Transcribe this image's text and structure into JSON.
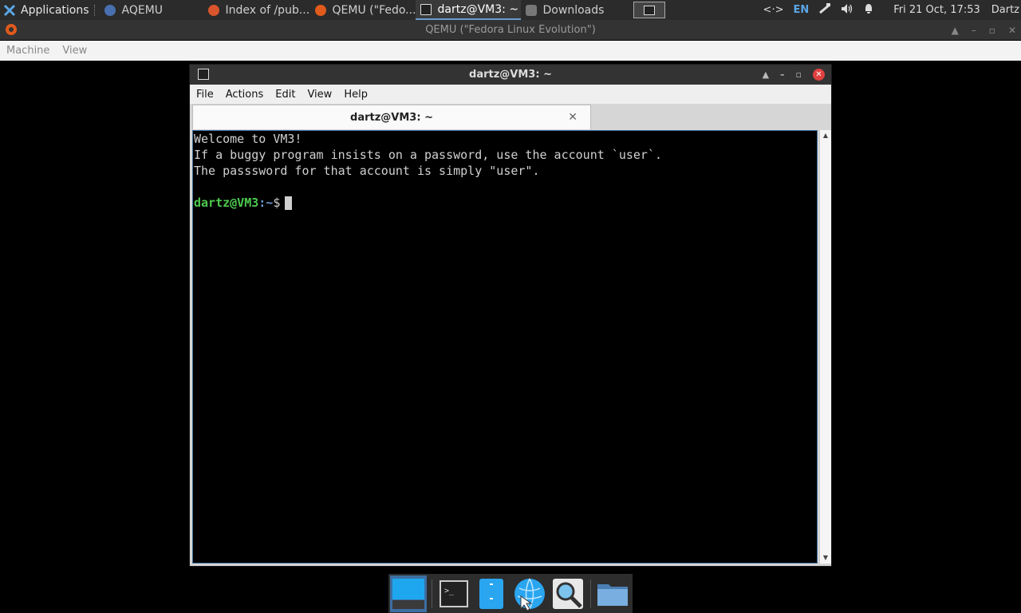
{
  "host_panel": {
    "applications_label": "Applications",
    "tasks": [
      {
        "label": "AQEMU",
        "icon": "aqemu-icon",
        "color": "#4a6fb0"
      },
      {
        "label": "Index of /pub...",
        "icon": "firefox-icon",
        "color": "#d9552b"
      },
      {
        "label": "QEMU (\"Fedo...",
        "icon": "qemu-icon",
        "color": "#e05a1c"
      },
      {
        "label": "dartz@VM3: ~",
        "icon": "terminal-icon",
        "color": "#222222"
      },
      {
        "label": "Downloads",
        "icon": "folder-icon",
        "color": "#777777"
      }
    ],
    "tray": {
      "network": "<·>",
      "keyboard_layout": "EN",
      "datetime": "Fri 21 Oct, 17:53",
      "user": "Dartz"
    }
  },
  "qemu_window": {
    "title": "QEMU (\"Fedora Linux Evolution\")",
    "menu": [
      "Machine",
      "View"
    ]
  },
  "terminal_window": {
    "title": "dartz@VM3: ~",
    "menu": [
      "File",
      "Actions",
      "Edit",
      "View",
      "Help"
    ],
    "tab_label": "dartz@VM3: ~",
    "lines": [
      "Welcome to VM3!",
      "If a buggy program insists on a password, use the account `user`.",
      "The passsword for that account is simply \"user\"."
    ],
    "prompt_user": "dartz@VM3",
    "prompt_path": ":~",
    "prompt_symbol": "$"
  },
  "dock": {
    "items": [
      "desktop-icon",
      "terminal-icon",
      "file-manager-icon",
      "web-browser-icon",
      "search-icon",
      "folder-icon"
    ]
  },
  "colors": {
    "prompt_user": "#4ec94e",
    "prompt_path": "#6b9bd1",
    "accent": "#3d6fa3"
  }
}
